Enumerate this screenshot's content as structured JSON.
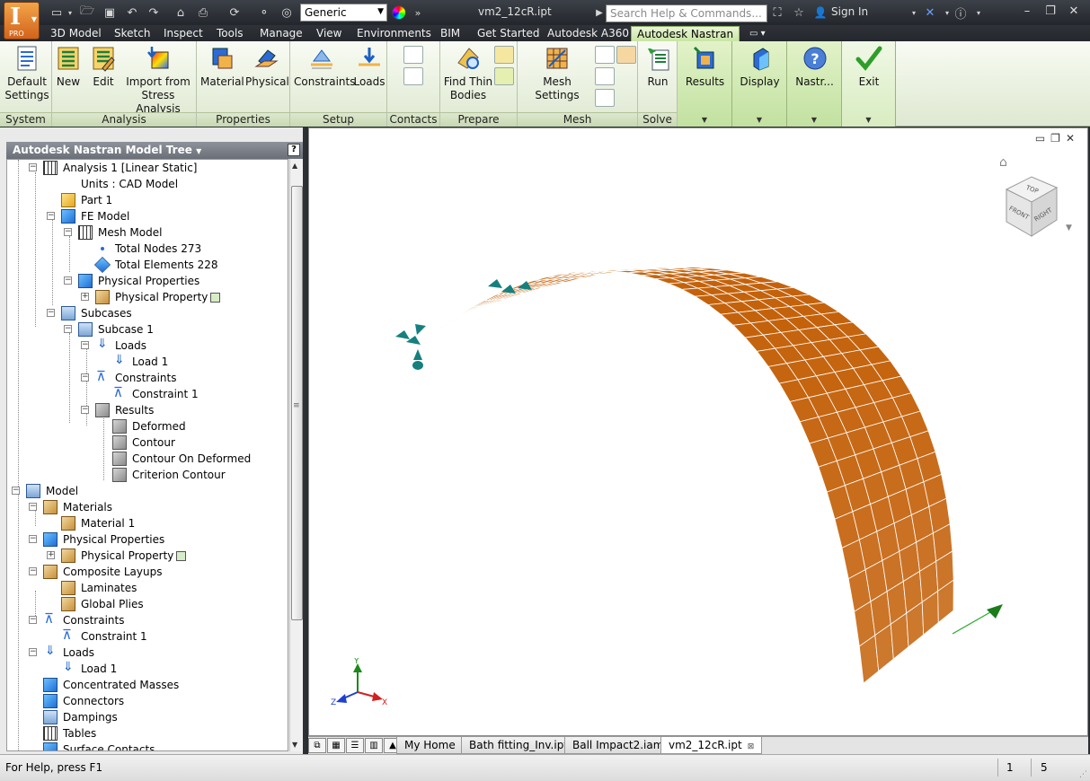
{
  "app": {
    "logo_letter": "I",
    "logo_badge": "PRO",
    "document_title": "vm2_12cR.ipt"
  },
  "toolbar": {
    "appearance_value": "Generic",
    "search_placeholder": "Search Help & Commands...",
    "sign_in_label": "Sign In"
  },
  "menu_tabs": [
    "3D Model",
    "Sketch",
    "Inspect",
    "Tools",
    "Manage",
    "View",
    "Environments",
    "BIM",
    "Get Started",
    "Autodesk A360",
    "Autodesk Nastran"
  ],
  "active_menu_tab": "Autodesk Nastran",
  "ribbon": {
    "panels": [
      {
        "label": "System",
        "buttons": [
          "Default\nSettings"
        ]
      },
      {
        "label": "Analysis",
        "buttons": [
          "New",
          "Edit",
          "Import from\nStress Analysis"
        ]
      },
      {
        "label": "Properties",
        "buttons": [
          "Material",
          "Physical"
        ]
      },
      {
        "label": "Setup",
        "buttons": [
          "Constraints",
          "Loads"
        ]
      },
      {
        "label": "Contacts",
        "buttons": []
      },
      {
        "label": "Prepare",
        "buttons": [
          "Find Thin\nBodies"
        ]
      },
      {
        "label": "Mesh",
        "buttons": [
          "Mesh Settings"
        ]
      },
      {
        "label": "Solve",
        "buttons": [
          "Run"
        ]
      }
    ],
    "side_buttons": [
      "Results",
      "Display",
      "Nastr...",
      "Exit"
    ]
  },
  "browser": {
    "title": "Autodesk Nastran Model Tree",
    "help": "?",
    "nodes": [
      {
        "label": "Analysis 1  [Linear Static]"
      },
      {
        "label": "Units : CAD Model"
      },
      {
        "label": "Part 1"
      },
      {
        "label": "FE Model"
      },
      {
        "label": "Mesh Model"
      },
      {
        "label": "Total Nodes 273"
      },
      {
        "label": "Total Elements 228"
      },
      {
        "label": "Physical Properties"
      },
      {
        "label": "Physical Property 1"
      },
      {
        "label": "Subcases"
      },
      {
        "label": "Subcase 1"
      },
      {
        "label": "Loads"
      },
      {
        "label": "Load 1"
      },
      {
        "label": "Constraints"
      },
      {
        "label": "Constraint 1"
      },
      {
        "label": "Results"
      },
      {
        "label": "Deformed"
      },
      {
        "label": "Contour"
      },
      {
        "label": "Contour On Deformed"
      },
      {
        "label": "Criterion Contour"
      },
      {
        "label": "Model"
      },
      {
        "label": "Materials"
      },
      {
        "label": "Material 1"
      },
      {
        "label": "Physical Properties"
      },
      {
        "label": "Physical Property 1"
      },
      {
        "label": "Composite Layups"
      },
      {
        "label": "Laminates"
      },
      {
        "label": "Global Plies"
      },
      {
        "label": "Constraints"
      },
      {
        "label": "Constraint 1"
      },
      {
        "label": "Loads"
      },
      {
        "label": "Load 1"
      },
      {
        "label": "Concentrated Masses"
      },
      {
        "label": "Connectors"
      },
      {
        "label": "Dampings"
      },
      {
        "label": "Tables"
      },
      {
        "label": "Surface Contacts"
      }
    ]
  },
  "viewcube": {
    "top": "TOP",
    "front": "FRONT",
    "right": "RIGHT"
  },
  "triad": {
    "x": "X",
    "y": "Y",
    "z": "Z"
  },
  "document_tabs": [
    "My Home",
    "Bath fitting_Inv.ipt",
    "Ball Impact2.iam",
    "vm2_12cR.ipt"
  ],
  "active_document_tab": "vm2_12cR.ipt",
  "status": {
    "help_text": "For Help, press F1",
    "count_a": "1",
    "count_b": "5"
  },
  "colors": {
    "mesh_fill": "#c4620b",
    "mesh_line": "#ffffff",
    "constraint": "#15807f",
    "load": "#1a7d1a",
    "active_tab": "#c9e5a3"
  }
}
